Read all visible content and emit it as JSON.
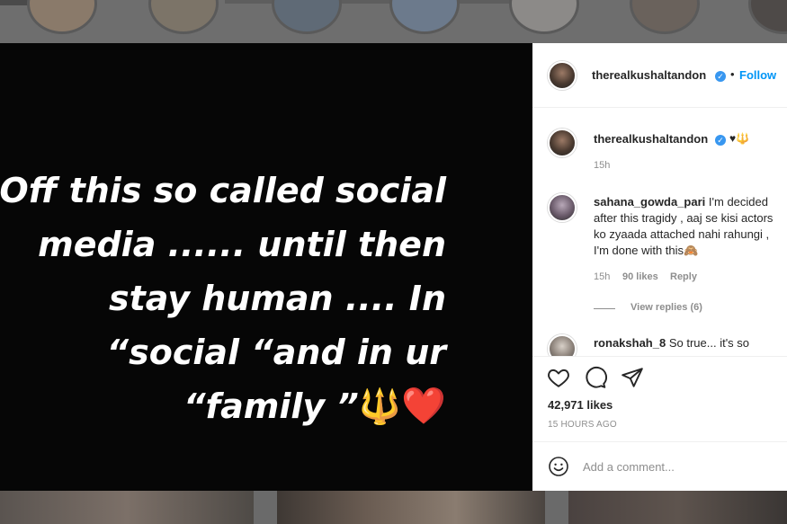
{
  "post": {
    "lines": [
      "Off this so called social",
      "media ...... until then",
      "stay human .... In",
      "“social “and in ur",
      "“family ”"
    ],
    "emoji_trident": "🔱",
    "emoji_heart": "❤️"
  },
  "header": {
    "username": "therealkushaltandon",
    "separator": "•",
    "follow_label": "Follow"
  },
  "caption": {
    "username": "therealkushaltandon",
    "text": "♥🔱",
    "time": "15h"
  },
  "comments": [
    {
      "username": "sahana_gowda_pari",
      "text": "I'm decided after this tragidy , aaj se kisi actors ko zyaada attached nahi rahungi , I'm done with this🙈",
      "time": "15h",
      "likes": "90 likes",
      "reply_label": "Reply",
      "view_replies": "View replies (6)"
    },
    {
      "username": "ronakshah_8",
      "text": "So true... it's so"
    }
  ],
  "actions": {
    "likes_count": "42,971 likes",
    "timestamp": "15 HOURS AGO"
  },
  "add_comment": {
    "placeholder": "Add a comment..."
  },
  "colors": {
    "accent": "#0095f6",
    "verified": "#3897f0",
    "heart": "#e1232b",
    "trident": "#e3b02a"
  }
}
